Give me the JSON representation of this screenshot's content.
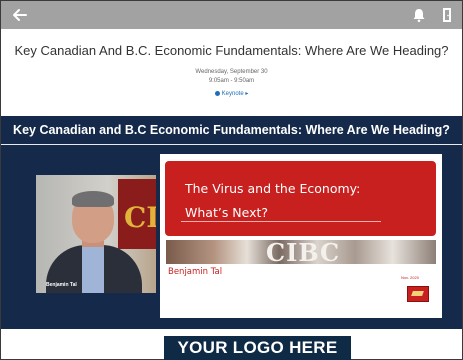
{
  "header": {
    "icons": [
      "back-arrow-icon",
      "bell-icon",
      "exit-icon"
    ]
  },
  "session": {
    "title": "Key Canadian And B.C. Economic Fundamentals: Where Are We Heading?",
    "date": "Wednesday, September 30",
    "time": "9:05am - 9:50am",
    "keynote_label": "Keynote",
    "keynote_color": "#1f6fb8"
  },
  "stage": {
    "title": "Key Canadian and B.C Economic Fundamentals: Where Are We Heading?",
    "background": "#152a4a"
  },
  "speaker_video": {
    "name": "Benjamin Tal",
    "banner_text": "CI"
  },
  "slide": {
    "line1": "The Virus and the Economy:",
    "line2": "What’s Next?",
    "photo_text": "CIBC",
    "presenter": "Benjamin Tal",
    "date": "Nov. 2020",
    "accent": "#c81f1f"
  },
  "footer": {
    "logo_text": "YOUR LOGO HERE"
  }
}
